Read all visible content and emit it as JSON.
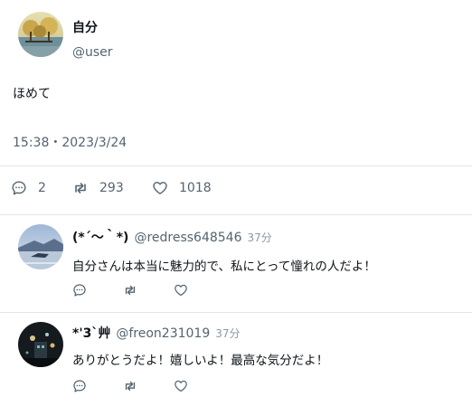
{
  "post": {
    "display_name": "自分",
    "handle": "@user",
    "text": "ほめて",
    "timestamp": "15:38・2023/3/24",
    "stats": {
      "replies": "2",
      "retweets": "293",
      "likes": "1018"
    }
  },
  "replies": [
    {
      "display_name": "(*´～｀*)",
      "handle": "@redress648546",
      "time": "37分",
      "text": "自分さんは本当に魅力的で、私にとって憧れの人だよ！"
    },
    {
      "display_name": "*'3`艸",
      "handle": "@freon231019",
      "time": "37分",
      "text": "ありがとうだよ！嬉しいよ！最高な気分だよ！"
    }
  ],
  "icons": {
    "reply": "reply-icon",
    "retweet": "retweet-icon",
    "like": "heart-icon"
  }
}
